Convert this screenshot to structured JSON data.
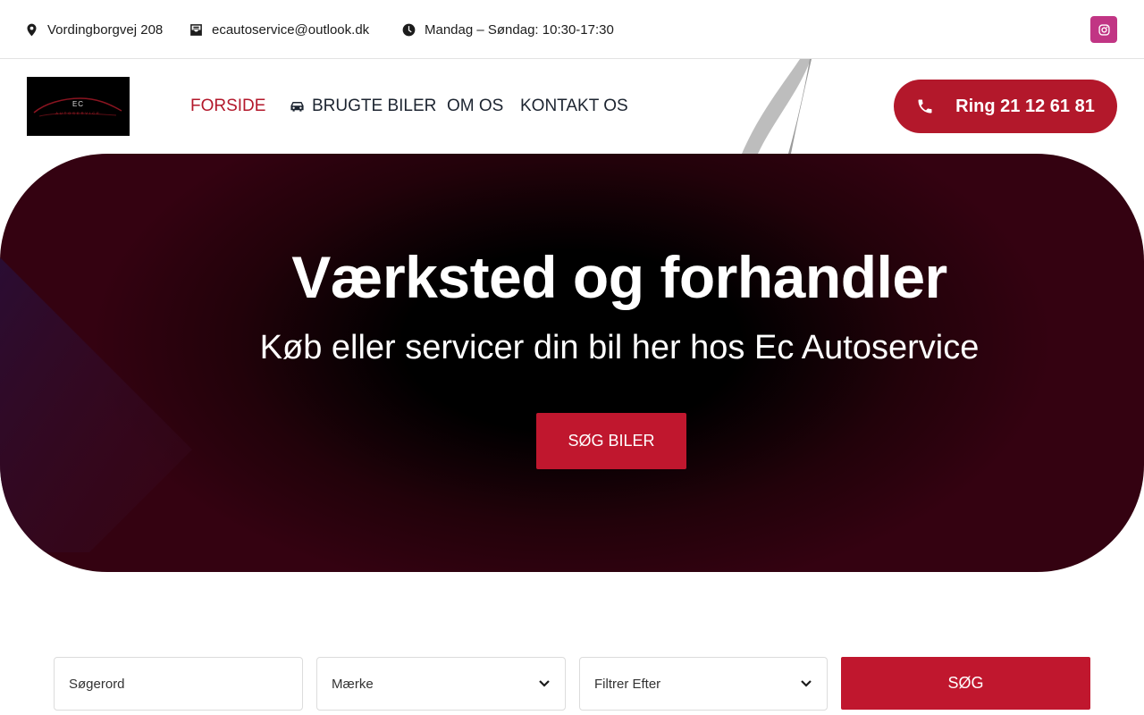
{
  "topbar": {
    "address": "Vordingborgvej 208",
    "email": "ecautoservice@outlook.dk",
    "hours": "Mandag – Søndag: 10:30-17:30",
    "social_icon": "instagram-icon",
    "social_color": "#c13584"
  },
  "header": {
    "logo_text": "EC",
    "logo_sub": "AUTOSERVICE",
    "nav": {
      "home": "FORSIDE",
      "cars": "BRUGTE BILER",
      "about": "OM OS",
      "contact": "KONTAKT OS"
    },
    "call_label": "Ring 21 12 61 81"
  },
  "hero": {
    "title": "Værksted og forhandler",
    "subtitle": "Køb eller servicer din bil her hos Ec Autoservice",
    "button_label": "SØG BILER"
  },
  "search": {
    "keyword_placeholder": "Søgerord",
    "brand_selected": "Mærke",
    "filter_selected": "Filtrer Efter",
    "button_label": "SØG"
  },
  "colors": {
    "accent": "#c0172e",
    "hero_dark": "#340211",
    "text": "#1c2430"
  }
}
